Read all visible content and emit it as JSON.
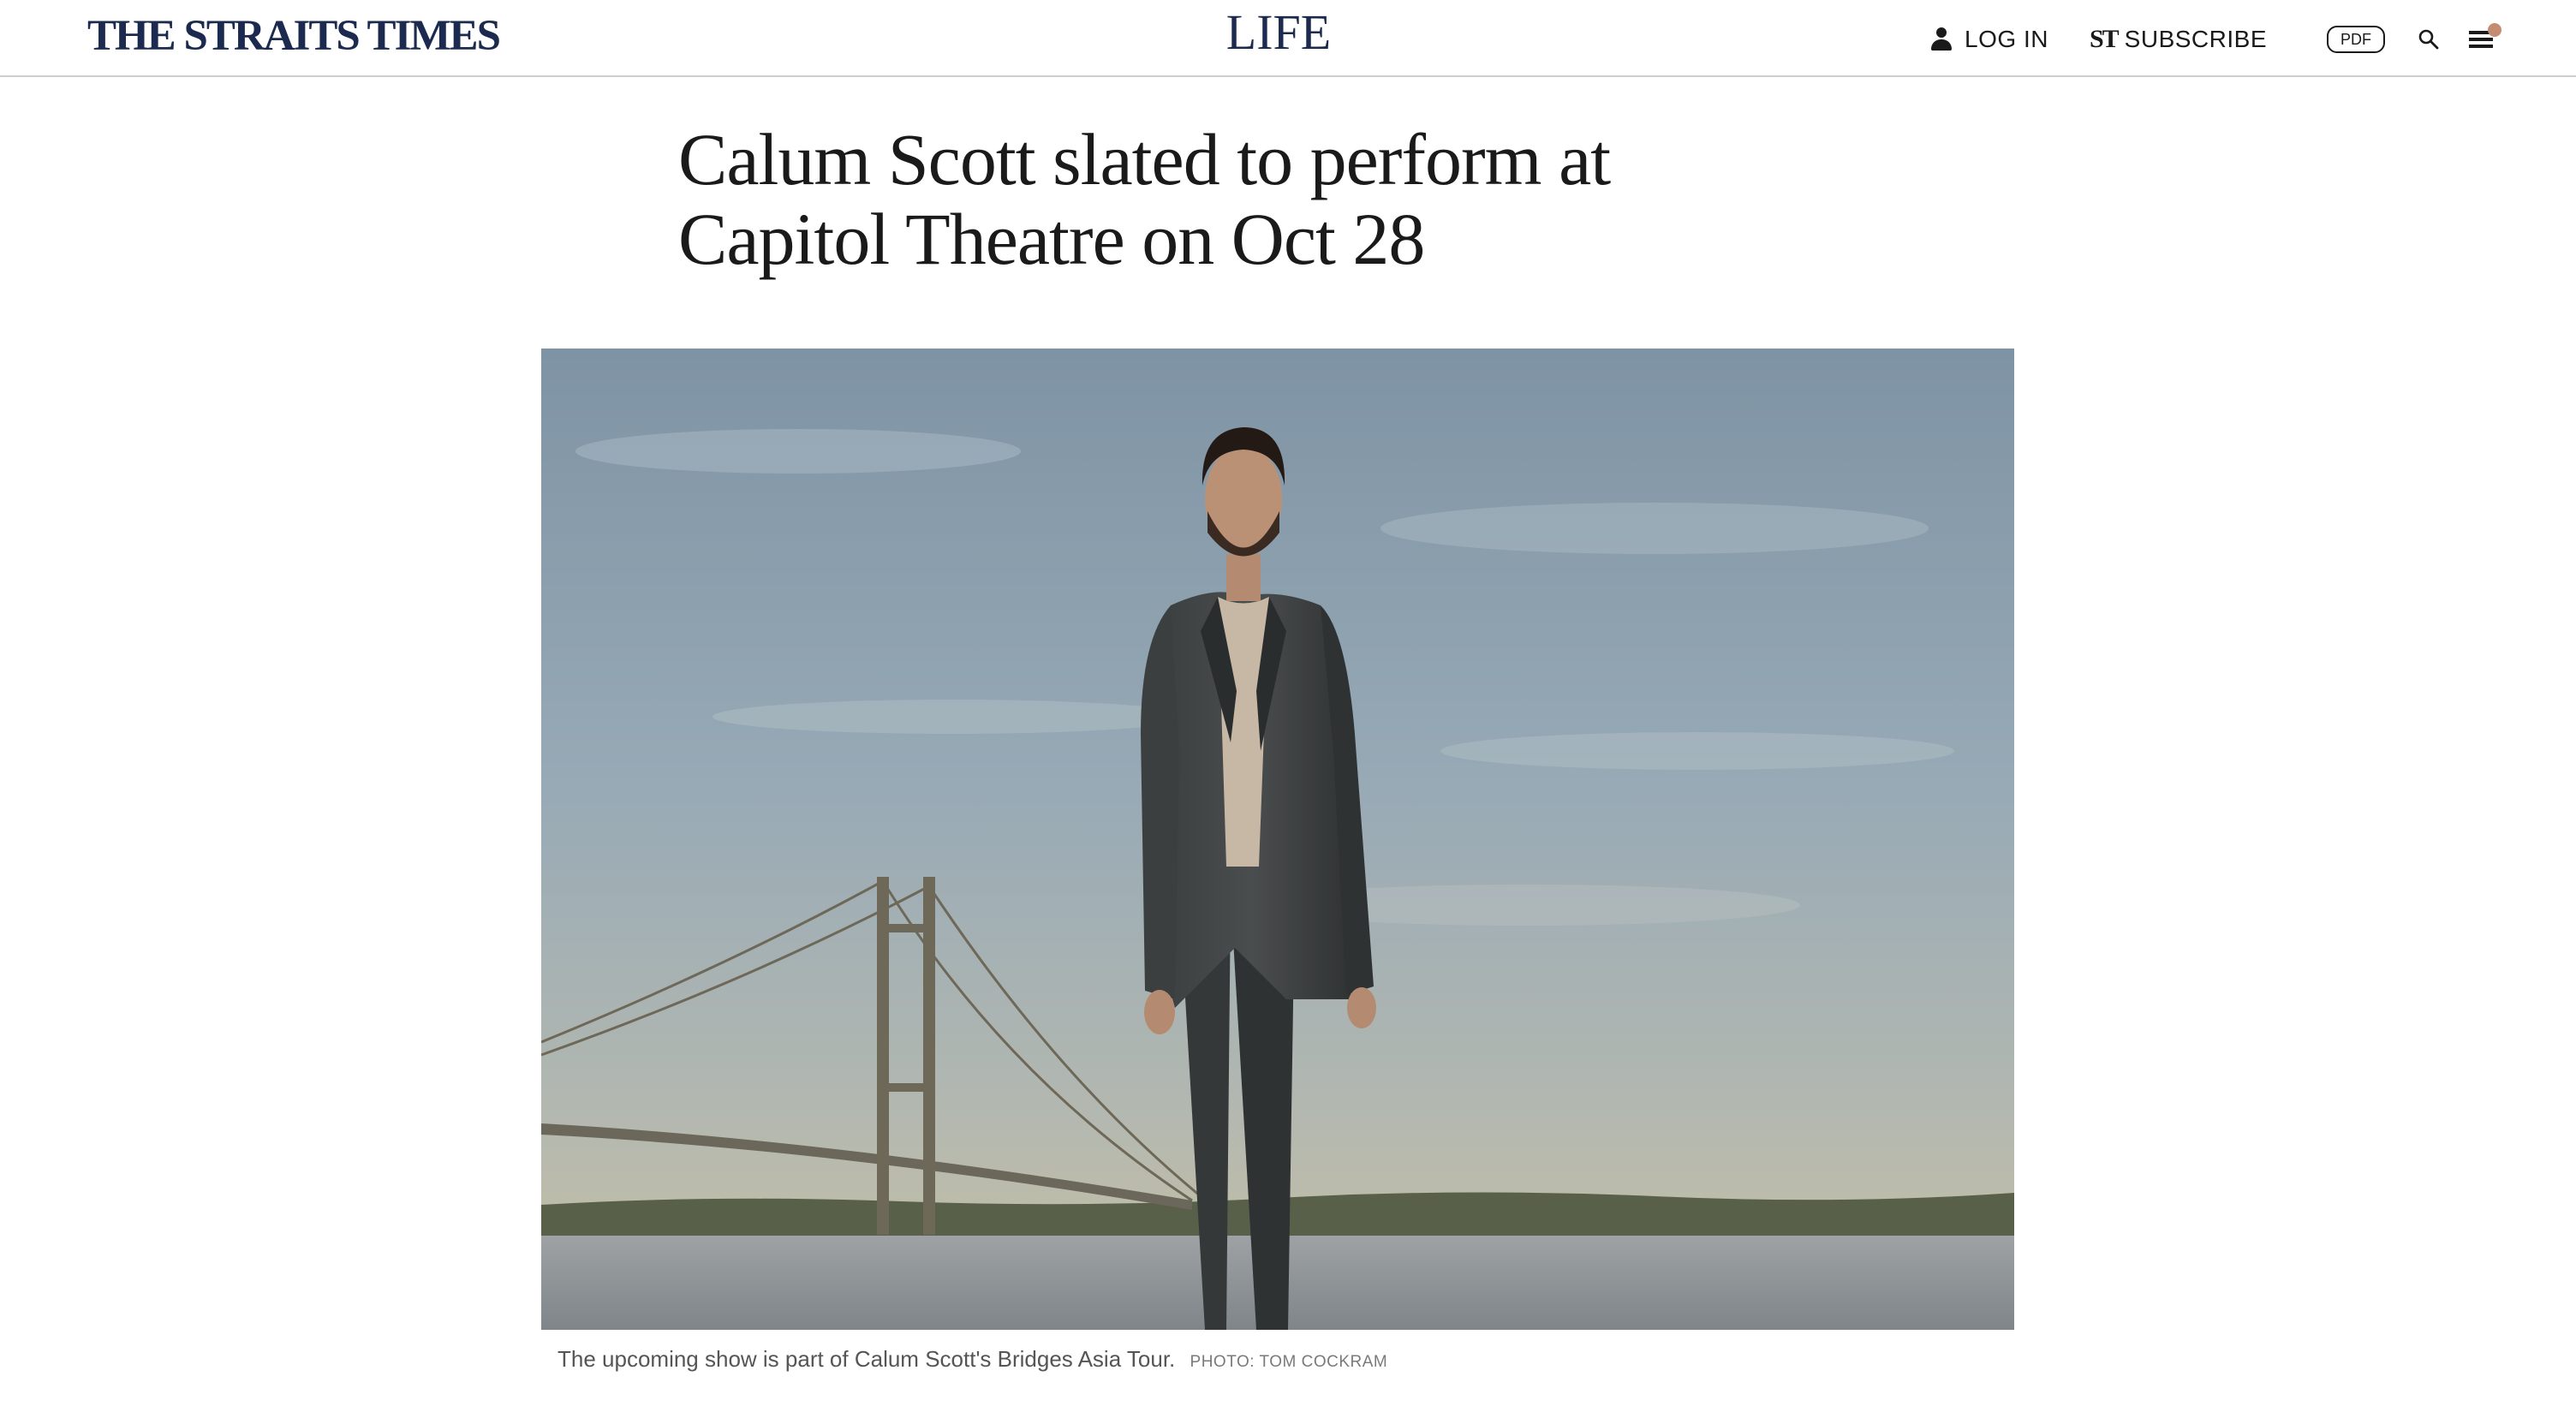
{
  "header": {
    "brand": "THE STRAITS TIMES",
    "section": "LIFE",
    "login_label": "LOG IN",
    "subscribe_mark": "ST",
    "subscribe_label": "SUBSCRIBE",
    "pdf_label": "PDF",
    "icons": {
      "login": "user-icon",
      "search": "search-icon",
      "menu": "hamburger-menu-icon"
    },
    "colors": {
      "brand": "#1b2a4e",
      "notification_dot": "#c48c72"
    }
  },
  "article": {
    "headline": "Calum Scott slated to perform at Capitol Theatre on Oct 28",
    "image_description_alt": "Calum Scott standing in a dark suit by a river with a suspension bridge behind him",
    "caption": "The upcoming show is part of Calum Scott's Bridges Asia Tour.",
    "credit": "PHOTO: TOM COCKRAM"
  }
}
